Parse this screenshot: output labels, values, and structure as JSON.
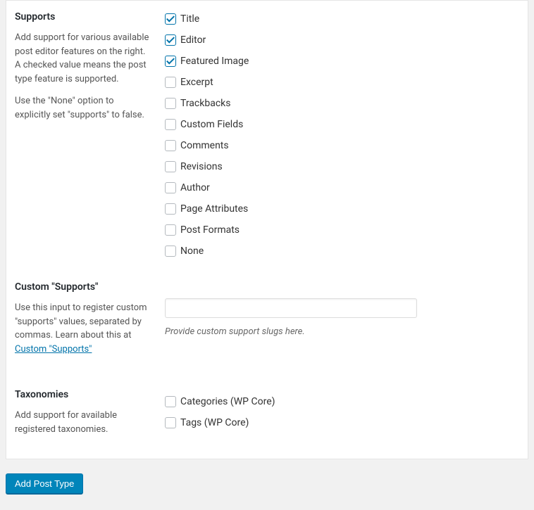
{
  "supports": {
    "title": "Supports",
    "desc1": "Add support for various available post editor features on the right. A checked value means the post type feature is supported.",
    "desc2": "Use the \"None\" option to explicitly set \"supports\" to false.",
    "options": [
      {
        "label": "Title",
        "checked": true
      },
      {
        "label": "Editor",
        "checked": true
      },
      {
        "label": "Featured Image",
        "checked": true
      },
      {
        "label": "Excerpt",
        "checked": false
      },
      {
        "label": "Trackbacks",
        "checked": false
      },
      {
        "label": "Custom Fields",
        "checked": false
      },
      {
        "label": "Comments",
        "checked": false
      },
      {
        "label": "Revisions",
        "checked": false
      },
      {
        "label": "Author",
        "checked": false
      },
      {
        "label": "Page Attributes",
        "checked": false
      },
      {
        "label": "Post Formats",
        "checked": false
      },
      {
        "label": "None",
        "checked": false
      }
    ]
  },
  "customSupports": {
    "title": "Custom \"Supports\"",
    "descPrefix": "Use this input to register custom \"supports\" values, separated by commas. Learn about this at ",
    "linkText": "Custom \"Supports\"",
    "inputValue": "",
    "helper": "Provide custom support slugs here."
  },
  "taxonomies": {
    "title": "Taxonomies",
    "desc": "Add support for available registered taxonomies.",
    "options": [
      {
        "label": "Categories (WP Core)",
        "checked": false
      },
      {
        "label": "Tags (WP Core)",
        "checked": false
      }
    ]
  },
  "submit": {
    "label": "Add Post Type"
  }
}
